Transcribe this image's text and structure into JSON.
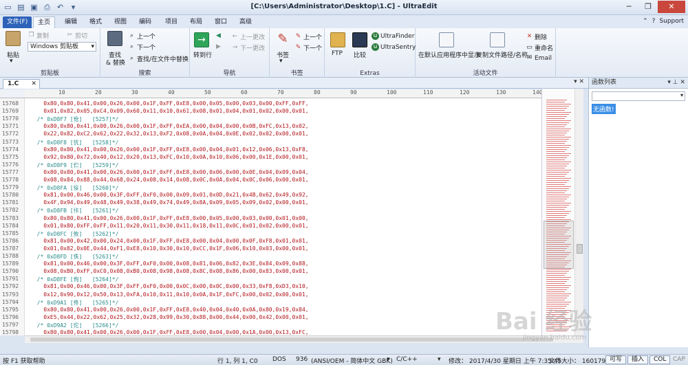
{
  "window": {
    "title": "[C:\\Users\\Administrator\\Desktop\\1.C] - UltraEdit",
    "controls": [
      "─",
      "❐",
      "✕"
    ]
  },
  "tabs": [
    "文件(F)",
    "主页",
    "编辑",
    "格式",
    "视图",
    "编码",
    "项目",
    "布局",
    "窗口",
    "高级"
  ],
  "help_menu": "Support",
  "ribbon": {
    "clipboard": {
      "paste": "粘贴",
      "copy": "复制",
      "cut": "剪切",
      "clipboard_select": "Windows 剪贴板",
      "label": "剪贴板"
    },
    "search": {
      "find_replace": "查找",
      "find_replace2": "& 替换",
      "prev": "上一个",
      "next": "下一个",
      "find_in_files": "查找/在文件中替换",
      "label": "搜索"
    },
    "navigate": {
      "goto": "转到行",
      "prev_change": "上一更改",
      "next_change": "下一更改",
      "label": "导航"
    },
    "bookmarks": {
      "bookmark": "书签",
      "prev": "上一个",
      "next": "下一个",
      "label": "书签"
    },
    "extras": {
      "ftp": "FTP",
      "compare": "比较",
      "finder": "UltraFinder",
      "sentry": "UltraSentry",
      "label": "Extras"
    },
    "active_file": {
      "open_default": "在默认应用程序中显示",
      "copy_path": "复制文件路径/名称",
      "delete": "删除",
      "rename": "重命名",
      "email": "Email",
      "label": "活动文件"
    }
  },
  "doc_tab": "1.C",
  "ruler_marks": [
    "10",
    "20",
    "30",
    "40",
    "50",
    "60",
    "70",
    "80",
    "90",
    "100",
    "110",
    "120",
    "130",
    "140"
  ],
  "lines": [
    {
      "n": "15768",
      "t": "data",
      "s": "    0x80,0x80,0x41,0x00,0x26,0x00,0x1F,0xFF,0xE8,0x00,0x05,0x00,0x03,0x00,0xFF,0xFF,"
    },
    {
      "n": "15769",
      "t": "data",
      "s": "    0x01,0x82,0x05,0xC4,0x09,0x60,0x11,0x10,0x61,0x08,0x01,0x04,0x01,0x02,0x00,0x01,"
    },
    {
      "n": "15770",
      "t": "comment",
      "s": "  /* 0xD8F7 [伧]   [5257]*/"
    },
    {
      "n": "15771",
      "t": "data",
      "s": "    0x80,0x80,0x41,0x00,0x26,0x00,0x1F,0xFF,0xEA,0x00,0x04,0x00,0x0B,0xFC,0x13,0x02,"
    },
    {
      "n": "15772",
      "t": "data",
      "s": "    0x22,0x82,0xC2,0x62,0x22,0x32,0x13,0xF2,0x08,0x0A,0x04,0x0E,0x02,0x02,0x00,0x01,"
    },
    {
      "n": "15773",
      "t": "comment",
      "s": "  /* 0xD8F8 [伉]   [5258]*/"
    },
    {
      "n": "15774",
      "t": "data",
      "s": "    0x80,0x80,0x41,0x00,0x26,0x00,0x1F,0xFF,0xE8,0x00,0x04,0x01,0x12,0x06,0x13,0xF8,"
    },
    {
      "n": "15775",
      "t": "data",
      "s": "    0x92,0x80,0x72,0x40,0x12,0x20,0x13,0xFC,0x10,0x0A,0x10,0x06,0x00,0x1E,0x00,0x01,"
    },
    {
      "n": "15776",
      "t": "comment",
      "s": "  /* 0xD8F9 [伫]   [5259]*/"
    },
    {
      "n": "15777",
      "t": "data",
      "s": "    0x80,0x80,0x41,0x00,0x26,0x00,0x1F,0xFF,0xE8,0x00,0x06,0x00,0x0E,0x04,0x09,0x04,"
    },
    {
      "n": "15778",
      "t": "data",
      "s": "    0x08,0x84,0x88,0x44,0x68,0x24,0x08,0x14,0x08,0x0C,0x0A,0x04,0x0C,0x06,0x00,0x01,"
    },
    {
      "n": "15779",
      "t": "comment",
      "s": "  /* 0xD8FA [佞]   [5260]*/"
    },
    {
      "n": "15780",
      "t": "data",
      "s": "    0x81,0x00,0x46,0x00,0x3F,0xFF,0xF0,0x00,0x09,0x01,0x0D,0x21,0x4B,0x62,0x49,0x92,"
    },
    {
      "n": "15781",
      "t": "data",
      "s": "    0x4F,0x94,0x49,0x48,0x49,0x38,0x49,0x74,0x49,0x8A,0x09,0x05,0x09,0x02,0x00,0x01,"
    },
    {
      "n": "15782",
      "t": "comment",
      "s": "  /* 0xD8FB [佧]   [5261]*/"
    },
    {
      "n": "15783",
      "t": "data",
      "s": "    0x80,0x80,0x41,0x00,0x26,0x00,0x1F,0xFF,0xE8,0x00,0x05,0x00,0x03,0x00,0x01,0x00,"
    },
    {
      "n": "15784",
      "t": "data",
      "s": "    0x01,0x80,0xFF,0xFF,0x11,0x20,0x11,0x30,0x11,0x18,0x11,0x0C,0x01,0x02,0x00,0x01,"
    },
    {
      "n": "15785",
      "t": "comment",
      "s": "  /* 0xD8FC [攸]   [5262]*/"
    },
    {
      "n": "15786",
      "t": "data",
      "s": "    0x81,0x00,0x42,0x00,0x24,0x00,0x1F,0xFF,0xE8,0x00,0x04,0x00,0x0F,0xF8,0x01,0x01,"
    },
    {
      "n": "15787",
      "t": "data",
      "s": "    0x01,0x82,0x0E,0x44,0xF1,0xE8,0x10,0x30,0x10,0xCC,0x1F,0x06,0x10,0x03,0x00,0x01,"
    },
    {
      "n": "15788",
      "t": "comment",
      "s": "  /* 0xD8FD [佚]   [5263]*/"
    },
    {
      "n": "15789",
      "t": "data",
      "s": "    0x81,0x00,0x46,0x00,0x3F,0xFF,0xF0,0x00,0x08,0x81,0x06,0x82,0x3E,0x84,0x09,0x88,"
    },
    {
      "n": "15790",
      "t": "data",
      "s": "    0x08,0xB0,0xFF,0xC0,0x08,0xB0,0x08,0x98,0x08,0x8C,0x08,0x86,0x00,0x83,0x00,0x01,"
    },
    {
      "n": "15791",
      "t": "comment",
      "s": "  /* 0xD8FE [佝]   [5264]*/"
    },
    {
      "n": "15792",
      "t": "data",
      "s": "    0x81,0x00,0x46,0x00,0x3F,0xFF,0xF0,0x00,0x0C,0x00,0x0C,0x00,0x33,0xF8,0xD3,0x10,"
    },
    {
      "n": "15793",
      "t": "data",
      "s": "    0x12,0x90,0x12,0x50,0x13,0xFA,0x10,0x11,0x10,0x0A,0x1F,0xFC,0x00,0x02,0x00,0x01,"
    },
    {
      "n": "15794",
      "t": "comment",
      "s": "  /* 0xD9A1 [佟]   [5265]*/"
    },
    {
      "n": "15795",
      "t": "data",
      "s": "    0x80,0x80,0x41,0x00,0x26,0x00,0x1F,0xFF,0xE8,0x40,0x04,0x40,0x0A,0x80,0x19,0x84,"
    },
    {
      "n": "15796",
      "t": "data",
      "s": "    0xE5,0x44,0x22,0x62,0x25,0x32,0x28,0x99,0x30,0x88,0x00,0x44,0x00,0x42,0x00,0x01,"
    },
    {
      "n": "15797",
      "t": "comment",
      "s": "  /* 0xD9A2 [佗]   [5266]*/"
    },
    {
      "n": "15798",
      "t": "data",
      "s": "    0x80,0x80,0x41,0x00,0x26,0x00,0x1F,0xFF,0xE8,0x00,0x04,0x00,0x1A,0x00,0x13,0xFC,"
    }
  ],
  "function_panel": {
    "title": "函数列表",
    "empty": "无函数!"
  },
  "status": {
    "help": "按 F1 获取帮助",
    "position": "行 1, 列 1, C0",
    "lineend": "DOS",
    "codepage": "936",
    "encoding": "(ANSI/OEM - 简体中文 GBK)",
    "syntax": "C/C++",
    "modified": "修改：  2017/4/30 星期日 上午 7:35:45",
    "filesize": "文件大小：  1601796",
    "writable": "可写",
    "insert": "插入",
    "col": "COL",
    "cap": "CAP"
  },
  "watermark": {
    "brand": "Bai 经验",
    "url": "jingyan.baidu.com"
  }
}
